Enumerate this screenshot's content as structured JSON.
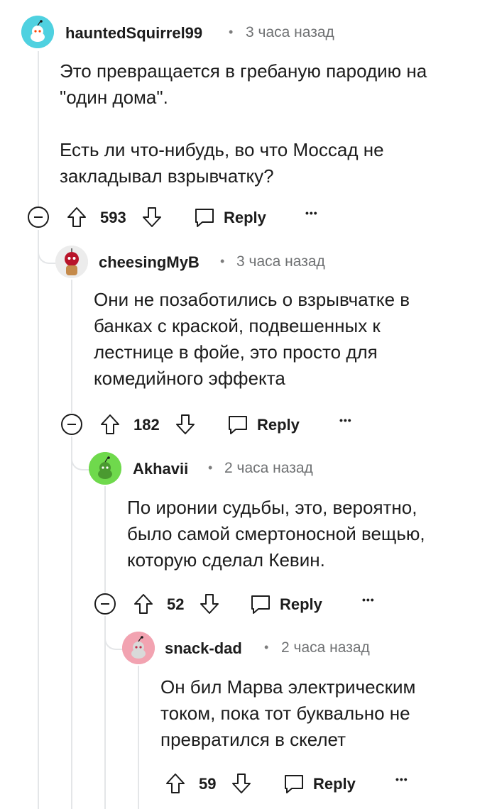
{
  "comments": [
    {
      "username": "hauntedSquirrel99",
      "time": "3 часа назад",
      "body": [
        "Это превращается в гребаную пародию на \"один дома\".",
        "Есть ли что-нибудь, во что Моссад не закладывал взрывчатку?"
      ],
      "score": "593",
      "reply_label": "Reply",
      "more_label": "•••",
      "avatar_color": "#4fd1e0"
    },
    {
      "username": "cheesingMyB",
      "time": "3 часа назад",
      "body": [
        "Они не позаботились о взрывчатке в банках с краской, подвешенных к лестнице в фойе, это просто для комедийного эффекта"
      ],
      "score": "182",
      "reply_label": "Reply",
      "more_label": "•••",
      "avatar_color": "#e8e8e8"
    },
    {
      "username": "Akhavii",
      "time": "2 часа назад",
      "body": [
        "По иронии судьбы, это, вероятно, было самой смертоносной вещью, которую сделал Кевин."
      ],
      "score": "52",
      "reply_label": "Reply",
      "more_label": "•••",
      "avatar_color": "#6fd94c"
    },
    {
      "username": "snack-dad",
      "time": "2 часа назад",
      "body": [
        "Он бил Марва электрическим током, пока тот буквально не превратился в скелет"
      ],
      "score": "59",
      "reply_label": "Reply",
      "more_label": "•••",
      "avatar_color": "#f2a3b1"
    }
  ],
  "separator": "•",
  "icons": {
    "collapse": "minus-circle-icon",
    "upvote": "arrow-up-icon",
    "downvote": "arrow-down-icon",
    "reply": "chat-bubble-icon",
    "more": "ellipsis-icon"
  }
}
